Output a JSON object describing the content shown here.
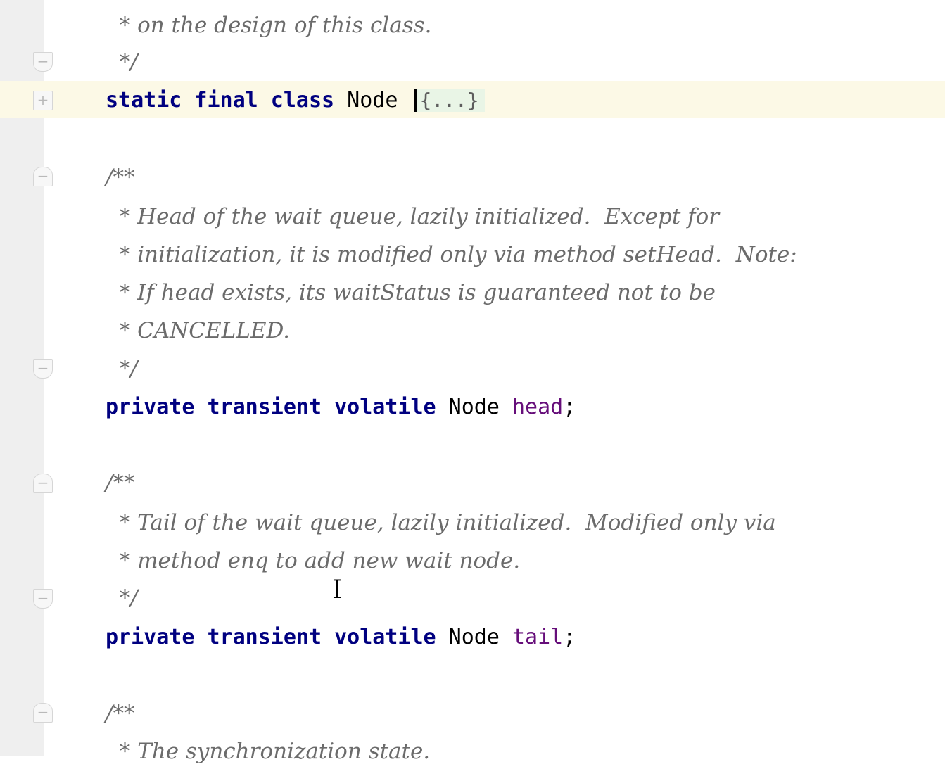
{
  "editor": {
    "lines": [
      {
        "type": "doc",
        "indent": "  ",
        "text": "* on the design of this class."
      },
      {
        "type": "doc",
        "indent": "  ",
        "text": "*/"
      },
      {
        "type": "code",
        "kw": "static final class ",
        "name": "Node ",
        "folded": "{...}"
      },
      {
        "type": "doc",
        "indent": "",
        "text": "/**"
      },
      {
        "type": "doc",
        "indent": "  ",
        "text": "* Head of the wait queue, lazily initialized.  Except for"
      },
      {
        "type": "doc",
        "indent": "  ",
        "text": "* initialization, it is modified only via method setHead.  Note:"
      },
      {
        "type": "doc",
        "indent": "  ",
        "text": "* If head exists, its waitStatus is guaranteed not to be"
      },
      {
        "type": "doc",
        "indent": "  ",
        "text": "* CANCELLED."
      },
      {
        "type": "doc",
        "indent": "  ",
        "text": "*/"
      },
      {
        "type": "field",
        "kw": "private transient volatile ",
        "typeName": "Node ",
        "field": "head",
        "end": ";"
      },
      {
        "type": "doc",
        "indent": "",
        "text": "/**"
      },
      {
        "type": "doc",
        "indent": "  ",
        "text": "* Tail of the wait queue, lazily initialized.  Modified only via"
      },
      {
        "type": "doc",
        "indent": "  ",
        "text": "* method enq to add new wait node."
      },
      {
        "type": "doc",
        "indent": "  ",
        "text": "*/"
      },
      {
        "type": "field",
        "kw": "private transient volatile ",
        "typeName": "Node ",
        "field": "tail",
        "end": ";"
      },
      {
        "type": "doc",
        "indent": "",
        "text": "/**"
      },
      {
        "type": "doc",
        "indent": "  ",
        "text": "* The synchronization state."
      }
    ],
    "fold_markers": {
      "expand": "+",
      "collapse": "−"
    },
    "ibeam": "I"
  }
}
